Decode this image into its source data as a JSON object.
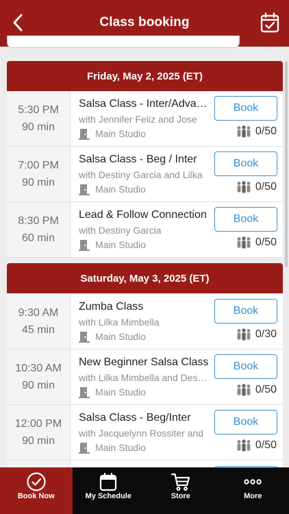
{
  "header": {
    "title": "Class booking",
    "back_icon": "chevron-left-icon",
    "action_icon": "calendar-check-icon"
  },
  "days": [
    {
      "label": "Friday, May 2, 2025 (ET)",
      "classes": [
        {
          "time": "5:30  PM",
          "duration": "90 min",
          "name": "Salsa Class - Inter/Advanced",
          "instructor": "with Jennifer Feliz and Jose",
          "room": "Main Studio",
          "book_label": "Book",
          "capacity": "0/50"
        },
        {
          "time": "7:00  PM",
          "duration": "90 min",
          "name": "Salsa Class - Beg / Inter",
          "instructor": "with Destiny Garcia and Lilka",
          "room": "Main Studio",
          "book_label": "Book",
          "capacity": "0/50"
        },
        {
          "time": "8:30  PM",
          "duration": "60 min",
          "name": "Lead & Follow Connection",
          "instructor": "with Destiny Garcia",
          "room": "Main Studio",
          "book_label": "Book",
          "capacity": "0/50"
        }
      ]
    },
    {
      "label": "Saturday, May 3, 2025 (ET)",
      "classes": [
        {
          "time": "9:30  AM",
          "duration": "45 min",
          "name": "Zumba Class",
          "instructor": "with Lilka Mimbella",
          "room": "Main Studio",
          "book_label": "Book",
          "capacity": "0/30"
        },
        {
          "time": "10:30  AM",
          "duration": "90 min",
          "name": "New Beginner Salsa Class",
          "instructor": "with Lilka Mimbella and Destiny",
          "room": "Main Studio",
          "book_label": "Book",
          "capacity": "0/50"
        },
        {
          "time": "12:00  PM",
          "duration": "90 min",
          "name": "Salsa Class - Beg/Inter",
          "instructor": "with Jacquelynn Rossiter and",
          "room": "Main Studio",
          "book_label": "Book",
          "capacity": "0/50"
        }
      ]
    }
  ],
  "tabs": [
    {
      "label": "Book Now",
      "icon": "check-circle-icon",
      "active": true
    },
    {
      "label": "My Schedule",
      "icon": "calendar-icon",
      "active": false
    },
    {
      "label": "Store",
      "icon": "cart-icon",
      "active": false
    },
    {
      "label": "More",
      "icon": "more-dots-icon",
      "active": false
    }
  ],
  "colors": {
    "brand": "#9a1c18",
    "book_button": "#3a8fd0",
    "tabbar": "#0b0b0b"
  }
}
